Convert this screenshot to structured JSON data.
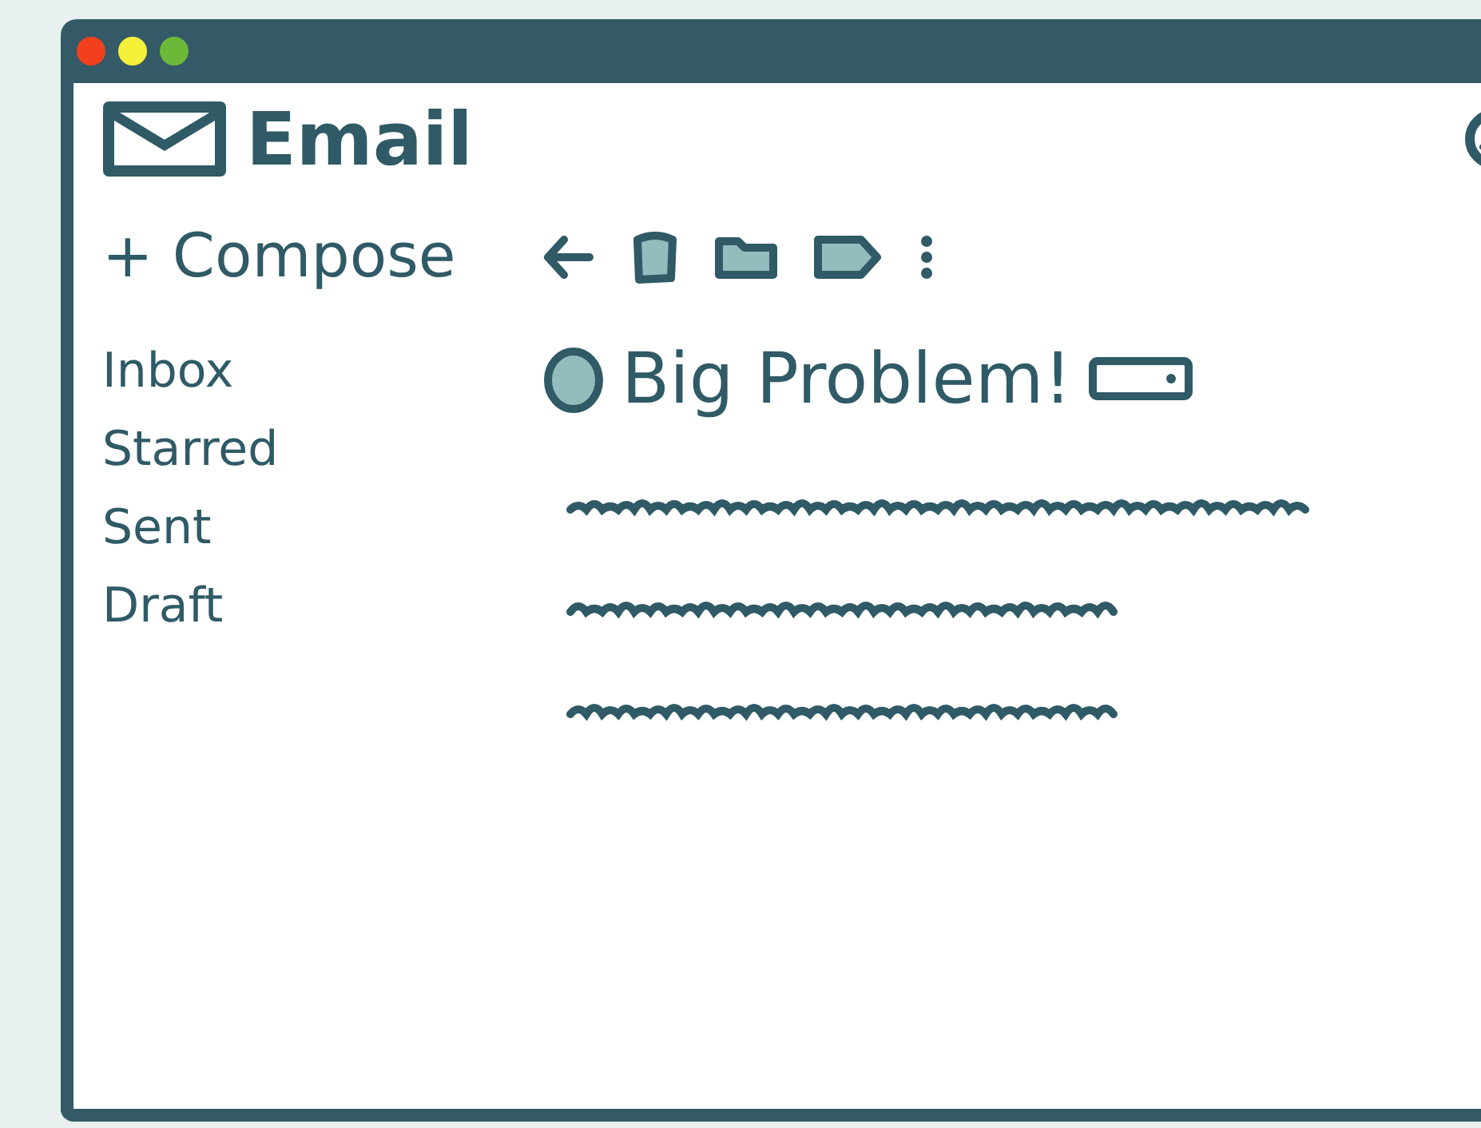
{
  "window": {
    "controls": [
      {
        "color": "#f2401f"
      },
      {
        "color": "#f5f03a"
      },
      {
        "color": "#6cb93a"
      }
    ]
  },
  "app": {
    "title": "Email"
  },
  "compose": {
    "label": "+ Compose"
  },
  "sidebar": {
    "items": [
      {
        "label": "Inbox"
      },
      {
        "label": "Starred"
      },
      {
        "label": "Sent"
      },
      {
        "label": "Draft"
      }
    ]
  },
  "message": {
    "subject": "Big Problem!"
  }
}
